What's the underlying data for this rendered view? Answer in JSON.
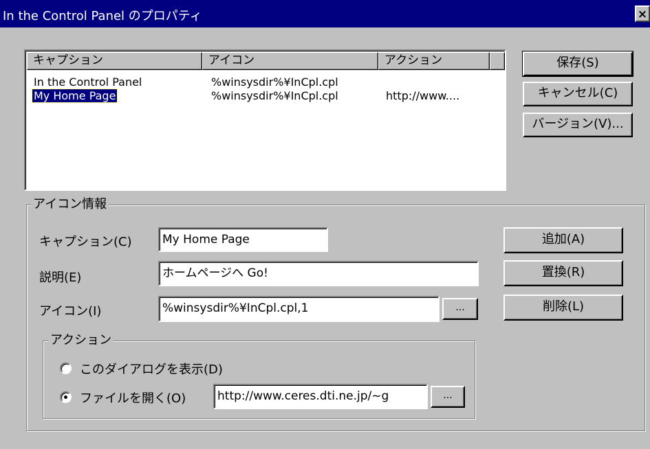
{
  "window": {
    "title": "In the Control Panel のプロパティ",
    "close_glyph": "×"
  },
  "list": {
    "columns": [
      "キャプション",
      "アイコン",
      "アクション"
    ],
    "rows": [
      {
        "caption": "In the Control Panel",
        "icon": "%winsysdir%¥InCpl.cpl",
        "action": "",
        "selected": false
      },
      {
        "caption": "My Home Page",
        "icon": "%winsysdir%¥InCpl.cpl",
        "action": "http://www....",
        "selected": true
      }
    ]
  },
  "buttons": {
    "save": "保存(S)",
    "cancel": "キャンセル(C)",
    "version": "バージョン(V)...",
    "add": "追加(A)",
    "replace": "置換(R)",
    "delete": "削除(L)",
    "browse": "..."
  },
  "icon_info": {
    "group_label": "アイコン情報",
    "caption_label": "キャプション(C)",
    "caption_value": "My Home Page",
    "description_label": "説明(E)",
    "description_value": "ホームページへ Go!",
    "icon_label": "アイコン(I)",
    "icon_value": "%winsysdir%¥InCpl.cpl,1"
  },
  "action": {
    "group_label": "アクション",
    "option_dialog": "このダイアログを表示(D)",
    "option_open_file": "ファイルを開く(O)",
    "selected_option": "open_file",
    "url_value": "http://www.ceres.dti.ne.jp/~g"
  }
}
